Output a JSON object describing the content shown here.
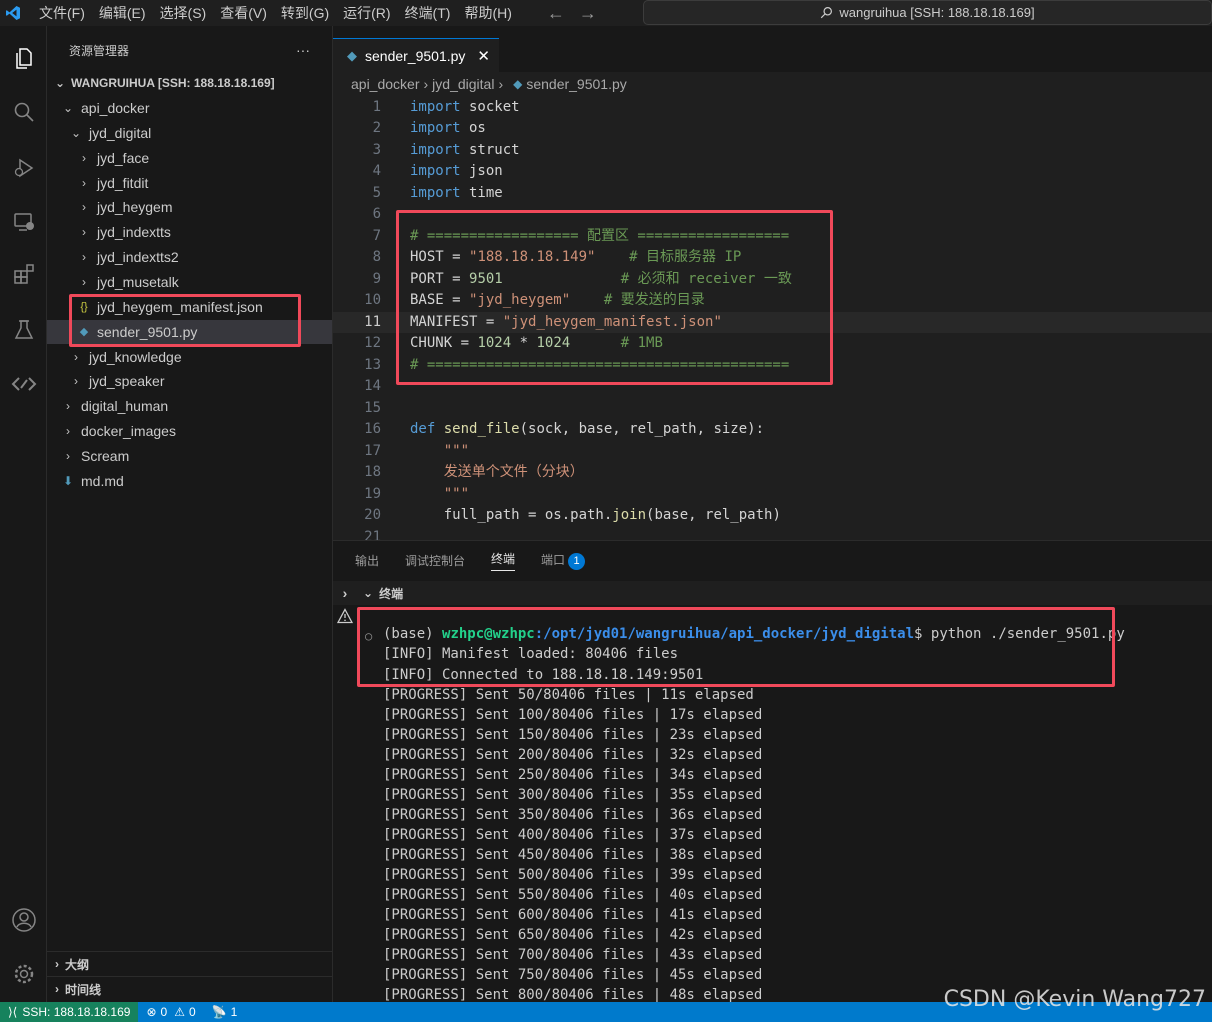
{
  "titlebar": {
    "menu": [
      "文件(F)",
      "编辑(E)",
      "选择(S)",
      "查看(V)",
      "转到(G)",
      "运行(R)",
      "终端(T)",
      "帮助(H)"
    ],
    "search_text": "wangruihua [SSH: 188.18.18.169]"
  },
  "sidebar": {
    "title": "资源管理器",
    "more": "···",
    "root": "WANGRUIHUA [SSH: 188.18.18.169]",
    "items": [
      {
        "label": "api_docker",
        "chev": "⌄"
      },
      {
        "label": "jyd_digital",
        "chev": "⌄"
      },
      {
        "label": "jyd_face",
        "chev": "›"
      },
      {
        "label": "jyd_fitdit",
        "chev": "›"
      },
      {
        "label": "jyd_heygem",
        "chev": "›"
      },
      {
        "label": "jyd_indextts",
        "chev": "›"
      },
      {
        "label": "jyd_indextts2",
        "chev": "›"
      },
      {
        "label": "jyd_musetalk",
        "chev": "›"
      },
      {
        "label": "jyd_heygem_manifest.json",
        "icon": "{}"
      },
      {
        "label": "sender_9501.py"
      },
      {
        "label": "jyd_knowledge",
        "chev": "›"
      },
      {
        "label": "jyd_speaker",
        "chev": "›"
      },
      {
        "label": "digital_human",
        "chev": "›"
      },
      {
        "label": "docker_images",
        "chev": "›"
      },
      {
        "label": "Scream",
        "chev": "›"
      },
      {
        "label": "md.md"
      }
    ],
    "outline": "大纲",
    "timeline": "时间线"
  },
  "editor": {
    "tab": "sender_9501.py",
    "breadcrumb": [
      "api_docker",
      "jyd_digital",
      "sender_9501.py"
    ],
    "line_numbers": [
      "1",
      "2",
      "3",
      "4",
      "5",
      "6",
      "7",
      "8",
      "9",
      "10",
      "11",
      "12",
      "13",
      "14",
      "15",
      "16",
      "17",
      "18",
      "19",
      "20",
      "21"
    ],
    "code": {
      "l1": [
        "import",
        " socket"
      ],
      "l2": [
        "import",
        " os"
      ],
      "l3": [
        "import",
        " struct"
      ],
      "l4": [
        "import",
        " json"
      ],
      "l5": [
        "import",
        " time"
      ],
      "l7": "# ================== 配置区 ==================",
      "l8": [
        "HOST",
        " = ",
        "\"188.18.18.149\"",
        "    # 目标服务器 IP"
      ],
      "l9": [
        "PORT",
        " = ",
        "9501",
        "              # 必须和 receiver 一致"
      ],
      "l10": [
        "BASE",
        " = ",
        "\"jyd_heygem\"",
        "    # 要发送的目录"
      ],
      "l11": [
        "MANIFEST",
        " = ",
        "\"jyd_heygem_manifest.json\""
      ],
      "l12": [
        "CHUNK",
        " = ",
        "1024",
        " * ",
        "1024",
        "      # 1MB"
      ],
      "l13": "# ===========================================",
      "l16": [
        "def",
        " ",
        "send_file",
        "(sock, base, rel_path, size):"
      ],
      "l17": "    \"\"\"",
      "l18": "    发送单个文件（分块）",
      "l19": "    \"\"\"",
      "l20": [
        "    full_path = os.path.",
        "join",
        "(base, rel_path)"
      ]
    }
  },
  "panel": {
    "tabs": [
      "输出",
      "调试控制台",
      "终端",
      "端口"
    ],
    "ports_badge": "1",
    "terminal_title": "终端",
    "prompt_prefix": "(base) ",
    "prompt_user": "wzhpc@wzhpc",
    "prompt_path": ":/opt/jyd01/wangruihua/api_docker/jyd_digital",
    "prompt_cmd": "$ python ./sender_9501.py",
    "info_lines": [
      "[INFO] Manifest loaded: 80406 files",
      "[INFO] Connected to 188.18.18.149:9501"
    ],
    "progress_lines": [
      "[PROGRESS] Sent 50/80406 files | 11s elapsed",
      "[PROGRESS] Sent 100/80406 files | 17s elapsed",
      "[PROGRESS] Sent 150/80406 files | 23s elapsed",
      "[PROGRESS] Sent 200/80406 files | 32s elapsed",
      "[PROGRESS] Sent 250/80406 files | 34s elapsed",
      "[PROGRESS] Sent 300/80406 files | 35s elapsed",
      "[PROGRESS] Sent 350/80406 files | 36s elapsed",
      "[PROGRESS] Sent 400/80406 files | 37s elapsed",
      "[PROGRESS] Sent 450/80406 files | 38s elapsed",
      "[PROGRESS] Sent 500/80406 files | 39s elapsed",
      "[PROGRESS] Sent 550/80406 files | 40s elapsed",
      "[PROGRESS] Sent 600/80406 files | 41s elapsed",
      "[PROGRESS] Sent 650/80406 files | 42s elapsed",
      "[PROGRESS] Sent 700/80406 files | 43s elapsed",
      "[PROGRESS] Sent 750/80406 files | 45s elapsed",
      "[PROGRESS] Sent 800/80406 files | 48s elapsed"
    ]
  },
  "statusbar": {
    "remote": "SSH: 188.18.18.169",
    "errors": "0",
    "warnings": "0",
    "ports": "1"
  },
  "watermark": "CSDN @Kevin Wang727",
  "colors": {
    "accent": "#007acc",
    "remote": "#16825d",
    "highlight": "#f0495a"
  }
}
